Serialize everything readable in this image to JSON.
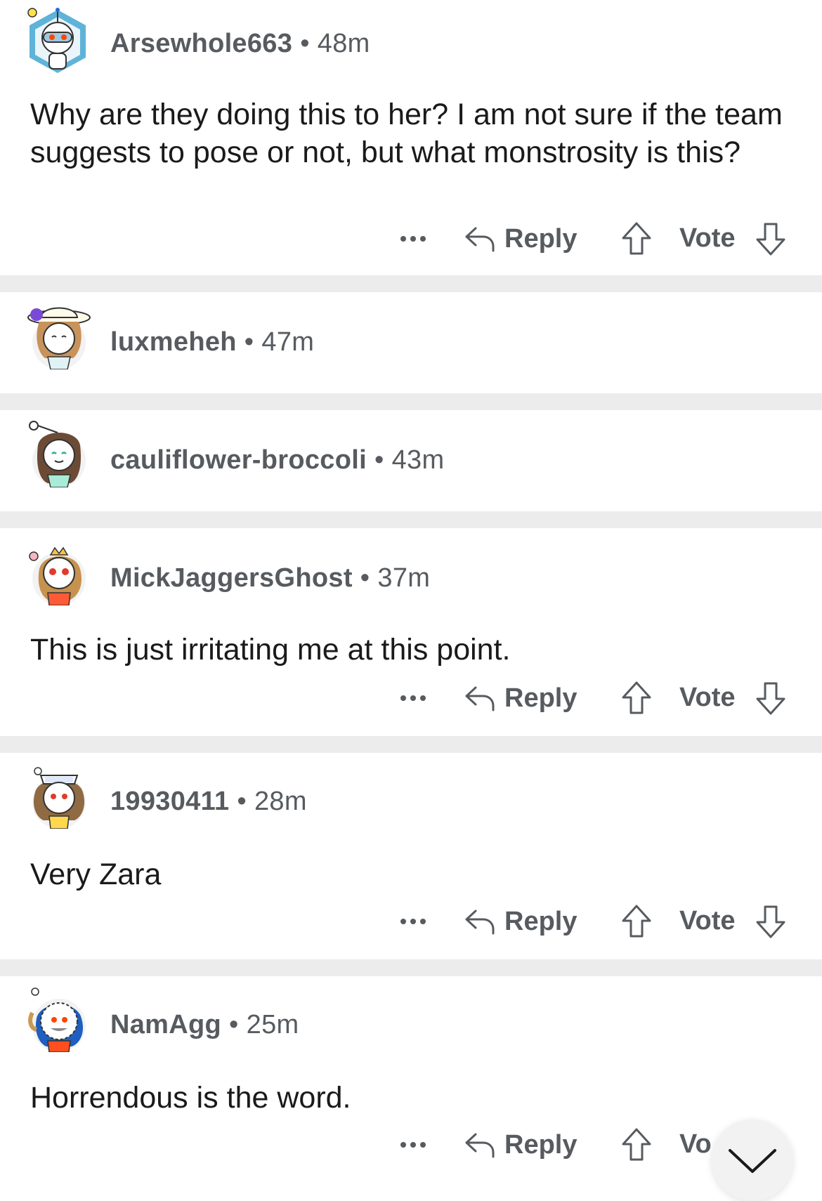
{
  "comments": [
    {
      "user": "Arsewhole663",
      "time": "48m",
      "text": "Why are they doing this to her? I am not sure if the team suggests to pose or not, but what monstrosity is this?",
      "avatar_icon": "snoo-astronaut-avatar-icon"
    },
    {
      "user": "luxmeheh",
      "time": "47m",
      "text": "",
      "avatar_icon": "snoo-sunhat-avatar-icon"
    },
    {
      "user": "cauliflower-broccoli",
      "time": "43m",
      "text": "",
      "avatar_icon": "snoo-brown-hair-avatar-icon"
    },
    {
      "user": "MickJaggersGhost",
      "time": "37m",
      "text": "This is just irritating me at this point.",
      "avatar_icon": "snoo-crown-avatar-icon"
    },
    {
      "user": "19930411",
      "time": "28m",
      "text": "Very Zara",
      "avatar_icon": "snoo-sailor-hat-avatar-icon"
    },
    {
      "user": "NamAgg",
      "time": "25m",
      "text": "Horrendous is the word.",
      "avatar_icon": "snoo-parka-avatar-icon"
    }
  ],
  "actions": {
    "reply": "Reply",
    "vote": "Vote",
    "vote_last_visible": "Vo"
  },
  "colors": {
    "separator": "#ececec",
    "meta": "#575b5f",
    "text": "#1a1a1b"
  }
}
